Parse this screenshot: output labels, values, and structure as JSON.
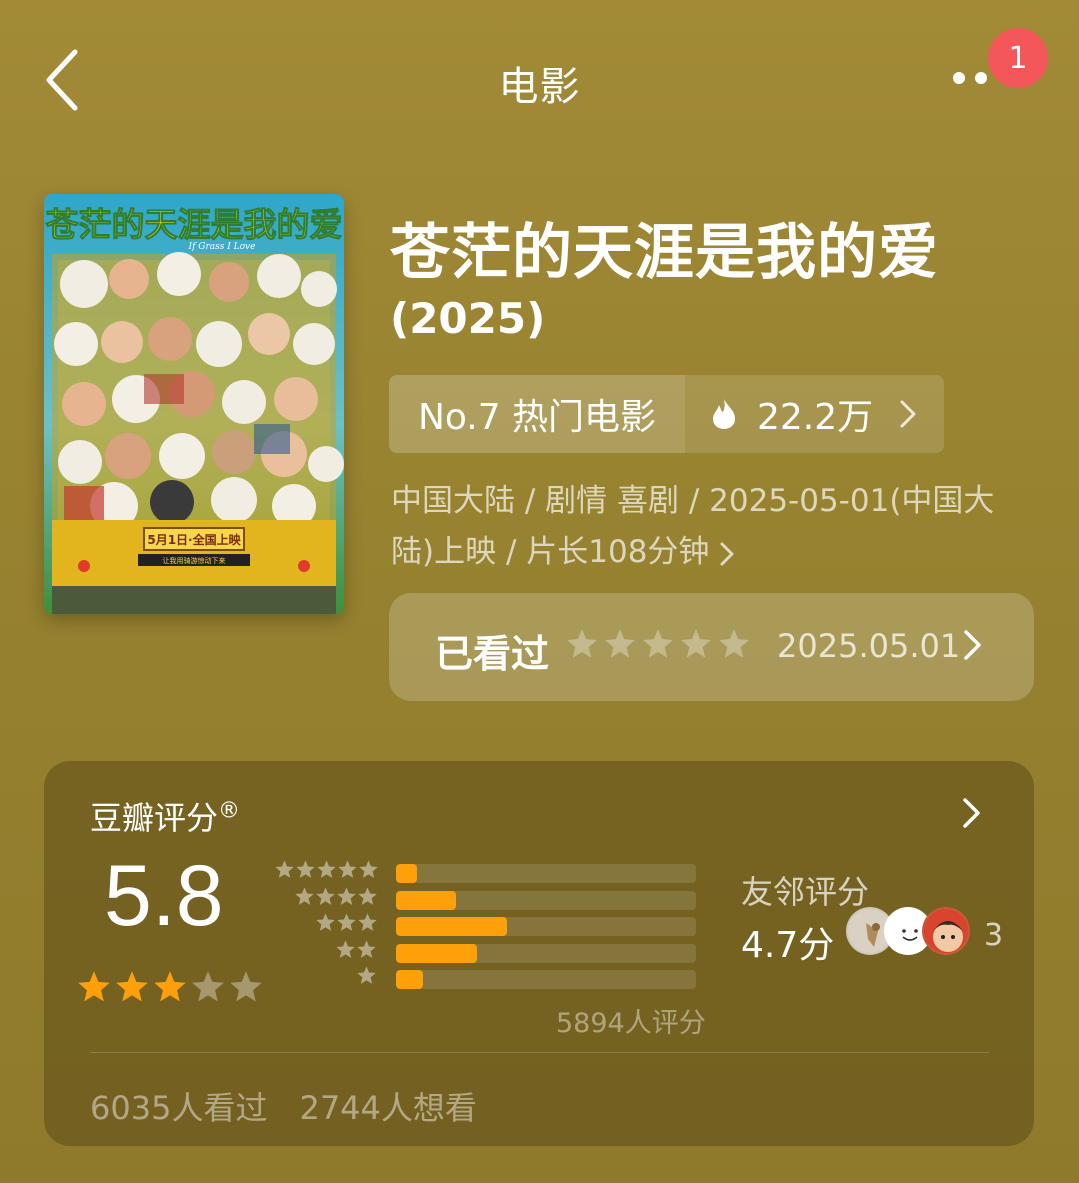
{
  "header": {
    "title": "电影",
    "badge_count": "1"
  },
  "movie": {
    "title": "苍茫的天涯是我的爱",
    "year": "(2025)",
    "poster": {
      "title_text": "苍茫的天涯是我的爱",
      "english_text": "If Grass I Love",
      "release_text": "5月1日·全国上映",
      "sub_text": "让我用骑游惊动下来"
    },
    "rank_label": "No.7 热门电影",
    "heat_value": "22.2万",
    "meta_text": "中国大陆 / 剧情 喜剧 / 2025-05-01(中国大陆)上映 / 片长108分钟"
  },
  "watched": {
    "label": "已看过",
    "date": "2025.05.01",
    "user_stars": 0
  },
  "rating": {
    "title": "豆瓣评分",
    "registered": "®",
    "score": "5.8",
    "stars": 3,
    "distribution": [
      {
        "stars": 5,
        "fraction": 0.07
      },
      {
        "stars": 4,
        "fraction": 0.2
      },
      {
        "stars": 3,
        "fraction": 0.37
      },
      {
        "stars": 2,
        "fraction": 0.27
      },
      {
        "stars": 1,
        "fraction": 0.09
      }
    ],
    "count_text": "5894人评分",
    "friend_label": "友邻评分",
    "friend_score": "4.7分",
    "friend_count": "3",
    "watched_text": "6035人看过",
    "wish_text": "2744人想看"
  },
  "colors": {
    "background": "#9a8433",
    "star_orange": "#ff9f0a",
    "badge_red": "#f4575a"
  }
}
